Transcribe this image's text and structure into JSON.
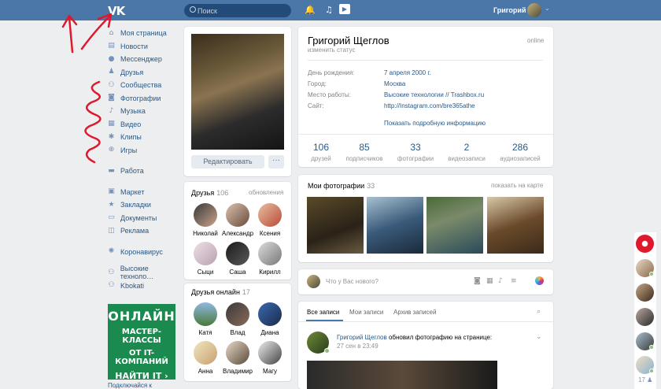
{
  "header": {
    "logo": "VK",
    "search_placeholder": "Поиск",
    "username": "Григорий",
    "icons": [
      "bell-icon",
      "music-note-icon",
      "play-icon"
    ]
  },
  "nav": {
    "items": [
      {
        "label": "Моя страница",
        "icon": "home-icon"
      },
      {
        "label": "Новости",
        "icon": "news-icon"
      },
      {
        "label": "Мессенджер",
        "icon": "message-icon"
      },
      {
        "label": "Друзья",
        "icon": "user-icon"
      },
      {
        "label": "Сообщества",
        "icon": "group-icon"
      },
      {
        "label": "Фотографии",
        "icon": "camera-icon"
      },
      {
        "label": "Музыка",
        "icon": "music-icon"
      },
      {
        "label": "Видео",
        "icon": "video-icon"
      },
      {
        "label": "Клипы",
        "icon": "clips-icon"
      },
      {
        "label": "Игры",
        "icon": "gamepad-icon"
      }
    ],
    "work": "Работа",
    "items2": [
      {
        "label": "Маркет",
        "icon": "market-icon"
      },
      {
        "label": "Закладки",
        "icon": "star-icon"
      },
      {
        "label": "Документы",
        "icon": "document-icon"
      },
      {
        "label": "Реклама",
        "icon": "ads-icon"
      }
    ],
    "corona": "Коронавирус",
    "items3": [
      {
        "label": "Высокие техноло…",
        "icon": "group-icon"
      },
      {
        "label": "Kbokati",
        "icon": "group-icon"
      }
    ],
    "promo": {
      "line1": "ОНЛАЙН",
      "line2": "МАСТЕР-КЛАССЫ",
      "line3": "ОТ IT-КОМПАНИЙ",
      "line4": "НАЙТИ IT ›"
    },
    "promo_caption": "Подключайся к"
  },
  "profile": {
    "edit_label": "Редактировать",
    "more_label": "···",
    "name": "Григорий Щеглов",
    "status": "изменить статус",
    "online": "online",
    "info": [
      {
        "label": "День рождения:",
        "value": "7 апреля 2000 г."
      },
      {
        "label": "Город:",
        "value": "Москва"
      },
      {
        "label": "Место работы:",
        "value": "Высокие технологии // Trashbox.ru"
      },
      {
        "label": "Сайт:",
        "value": "http://Instagram.com/bre365athe"
      }
    ],
    "more_info": "Показать подробную информацию",
    "stats": [
      {
        "n": "106",
        "l": "друзей"
      },
      {
        "n": "85",
        "l": "подписчиков"
      },
      {
        "n": "33",
        "l": "фотографии"
      },
      {
        "n": "2",
        "l": "видеозаписи"
      },
      {
        "n": "286",
        "l": "аудиозаписей"
      }
    ]
  },
  "friends": {
    "title": "Друзья",
    "count": "106",
    "link": "обновления",
    "list": [
      "Николай",
      "Александр…",
      "Ксения",
      "Сыци",
      "Саша",
      "Кирилл"
    ]
  },
  "friends_online": {
    "title": "Друзья онлайн",
    "count": "17",
    "list": [
      "Катя",
      "Влад",
      "Диана",
      "Анна",
      "Владимир",
      "Магу"
    ]
  },
  "photos": {
    "title": "Мои фотографии",
    "count": "33",
    "link": "показать на карте"
  },
  "composer": {
    "placeholder": "Что у Вас нового?"
  },
  "wall": {
    "tabs": [
      "Все записи",
      "Мои записи",
      "Архив записей"
    ],
    "post_author": "Григорий Щеглов",
    "post_action": " обновил фотографию на странице:",
    "post_time": "27 сен в 23:49"
  },
  "right_bar": {
    "count": "17"
  },
  "colors": {
    "header": "#4a76a8",
    "link": "#2a5885",
    "promo": "#1a8a4f",
    "annotation": "#e0182d"
  }
}
